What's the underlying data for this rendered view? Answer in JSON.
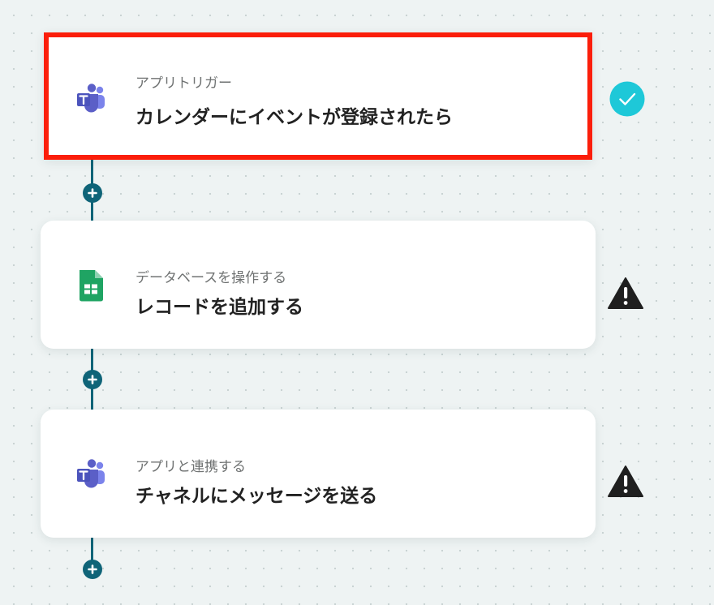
{
  "flow": {
    "steps": [
      {
        "category": "アプリトリガー",
        "title": "カレンダーにイベントが登録されたら",
        "app_icon": "microsoft-teams-icon",
        "status": "success",
        "selected": true
      },
      {
        "category": "データベースを操作する",
        "title": "レコードを追加する",
        "app_icon": "google-sheets-icon",
        "status": "warning",
        "selected": false
      },
      {
        "category": "アプリと連携する",
        "title": "チャネルにメッセージを送る",
        "app_icon": "microsoft-teams-icon",
        "status": "warning",
        "selected": false
      }
    ]
  },
  "colors": {
    "selection_border": "#fb1e0a",
    "connector": "#0f6478",
    "success": "#1ec8d8",
    "warning": "#1f1f1f",
    "teams_purple": "#5b5fc7",
    "sheets_green": "#1fa463"
  }
}
